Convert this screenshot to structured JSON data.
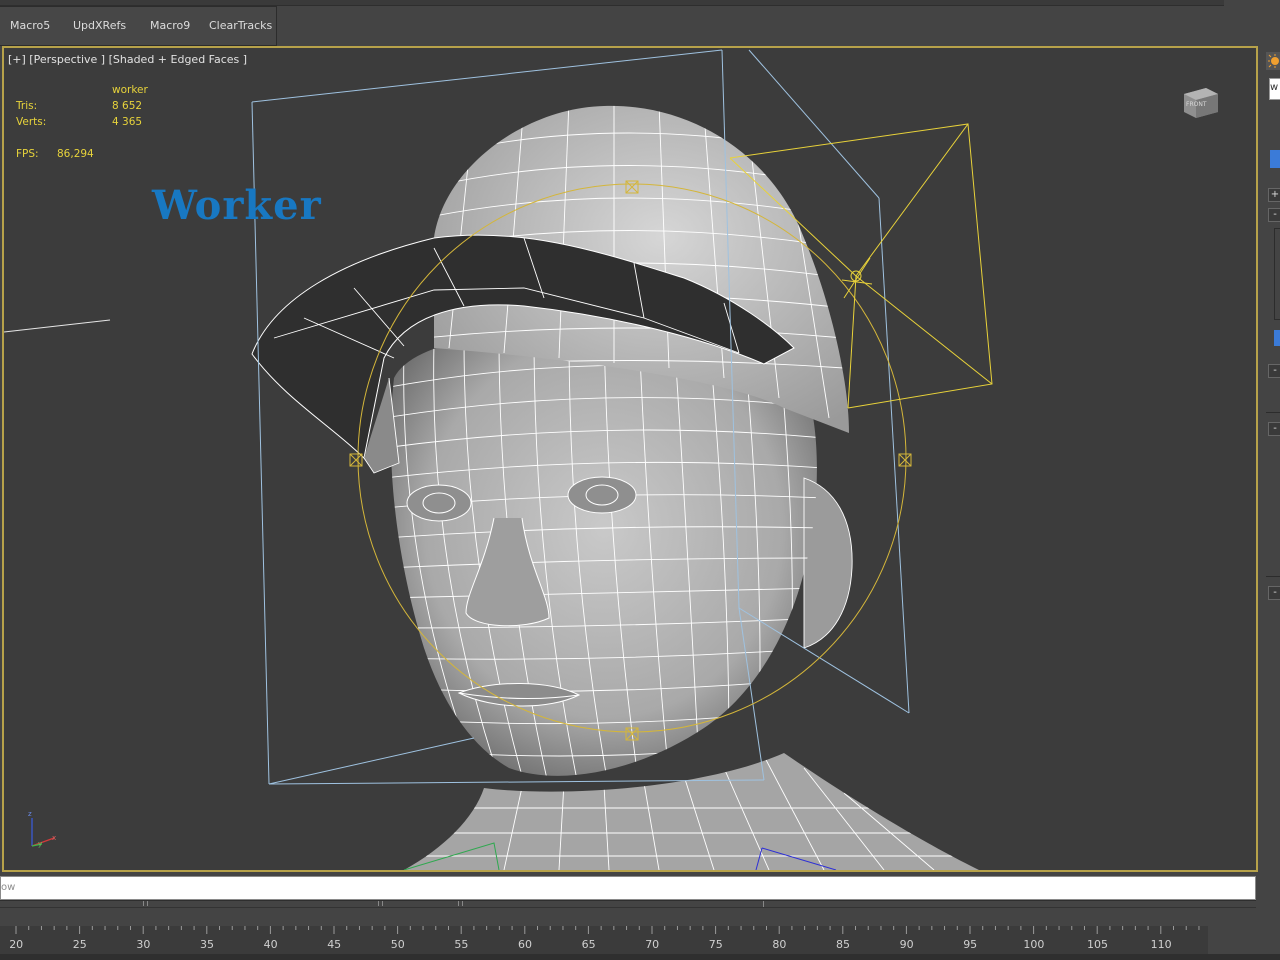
{
  "macros": [
    "Macro5",
    "UpdXRefs",
    "Macro9",
    "ClearTracks"
  ],
  "viewport": {
    "label": "[+] [Perspective ] [Shaded + Edged Faces ]",
    "object_name": "worker",
    "tris_label": "Tris:",
    "tris_value": "8 652",
    "verts_label": "Verts:",
    "verts_value": "4 365",
    "fps_label": "FPS:",
    "fps_value": "86,294",
    "title": "Worker",
    "viewcube_label": "FRONT",
    "gizmo_axis_z": "z",
    "gizmo_axis_x": "x",
    "gizmo_axis_y": "y"
  },
  "prompt": {
    "text": "ow"
  },
  "timeline": {
    "labels": [
      "20",
      "25",
      "30",
      "35",
      "40",
      "45",
      "50",
      "55",
      "60",
      "65",
      "70",
      "75",
      "80",
      "85",
      "90",
      "95",
      "100",
      "105",
      "110"
    ]
  },
  "colors": {
    "viewport_border": "#b7a24a",
    "stats_text": "#e7d33b",
    "title": "#1878c2",
    "light_gizmo": "#e8d23a",
    "bounding_box": "#9fc2e0"
  },
  "command_panel": {
    "tab_glyph": "w",
    "buttons": [
      "+",
      "-",
      "-",
      "-",
      "-"
    ]
  }
}
